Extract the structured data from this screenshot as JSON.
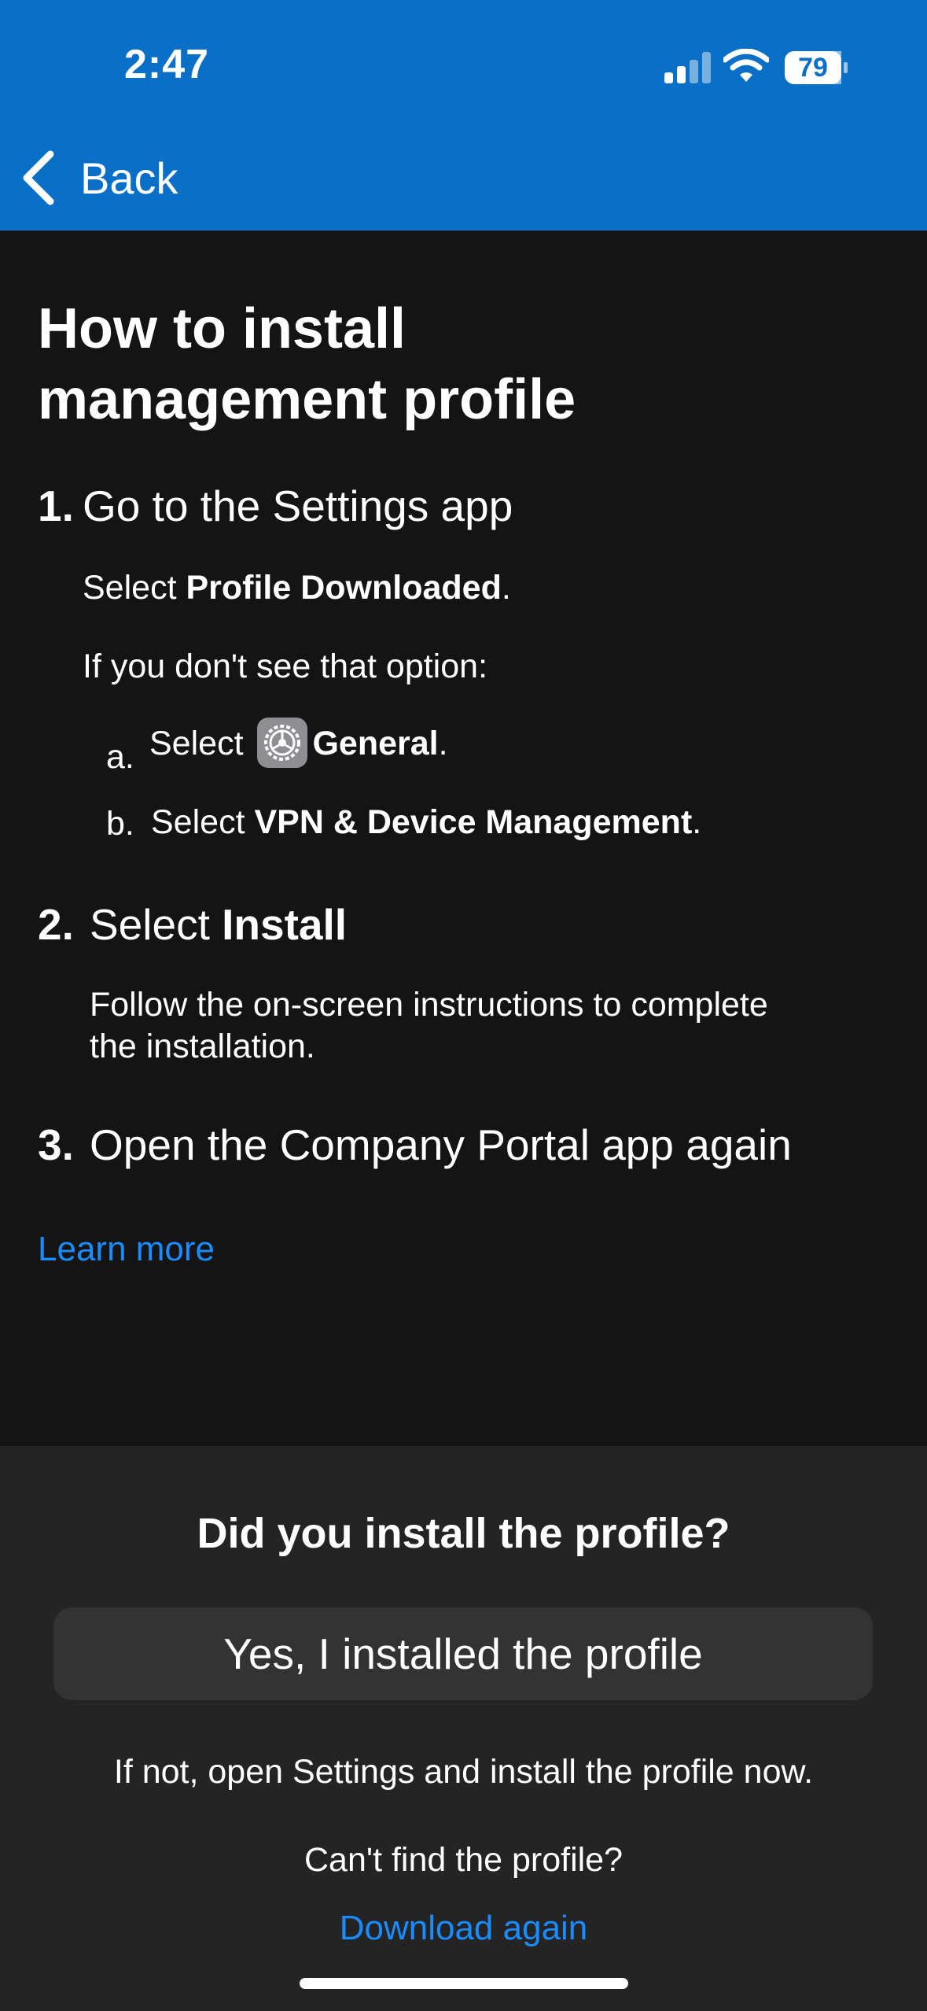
{
  "status_bar": {
    "time": "2:47",
    "battery_level": "79",
    "icons": [
      "cellular-signal-icon",
      "wifi-icon",
      "battery-icon"
    ]
  },
  "nav": {
    "back_label": "Back",
    "back_icon": "chevron-left-icon"
  },
  "page": {
    "title_line1": "How to install",
    "title_line2": "management profile",
    "steps": [
      {
        "number": "1.",
        "heading": "Go to the Settings app",
        "line1_prefix": "Select ",
        "line1_bold": "Profile Downloaded",
        "line1_suffix": ".",
        "line2": "If you don't see that option:",
        "subs": [
          {
            "marker": "a.",
            "prefix": "Select ",
            "icon": "settings-gear-icon",
            "bold": "General",
            "suffix": "."
          },
          {
            "marker": "b.",
            "prefix": "Select ",
            "bold": "VPN & Device Management",
            "suffix": "."
          }
        ]
      },
      {
        "number": "2.",
        "heading_prefix": "Select ",
        "heading_bold": "Install",
        "body_line1": "Follow the on-screen instructions to complete",
        "body_line2": "the installation."
      },
      {
        "number": "3.",
        "heading": "Open the Company Portal app again"
      }
    ],
    "learn_more": "Learn more"
  },
  "sheet": {
    "question": "Did you install the profile?",
    "yes_button": "Yes, I installed the profile",
    "note": "If not, open Settings and install the profile now.",
    "cant_find": "Can't find the profile?",
    "download_again": "Download again"
  },
  "colors": {
    "header_bg": "#0a6fc7",
    "content_bg": "#141414",
    "sheet_bg": "#242424",
    "button_bg": "#333333",
    "link": "#1a8cff"
  }
}
